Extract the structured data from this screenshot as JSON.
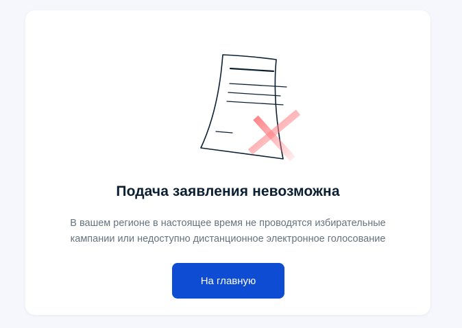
{
  "card": {
    "illustration_icon": "rejected-document-icon",
    "title": "Подача заявления невозможна",
    "description_line1": "В вашем регионе в настоящее время не проводятся избирательные",
    "description_line2": "кампании или недоступно дистанционное электронное голосование",
    "button_label": "На главную"
  },
  "colors": {
    "page_background": "#f5f7fc",
    "card_background": "#ffffff",
    "title_text": "#0b1f33",
    "description_text": "#66727f",
    "button_background": "#0d4cd3",
    "button_text": "#ffffff",
    "cross_mark": "#ff8f92"
  }
}
